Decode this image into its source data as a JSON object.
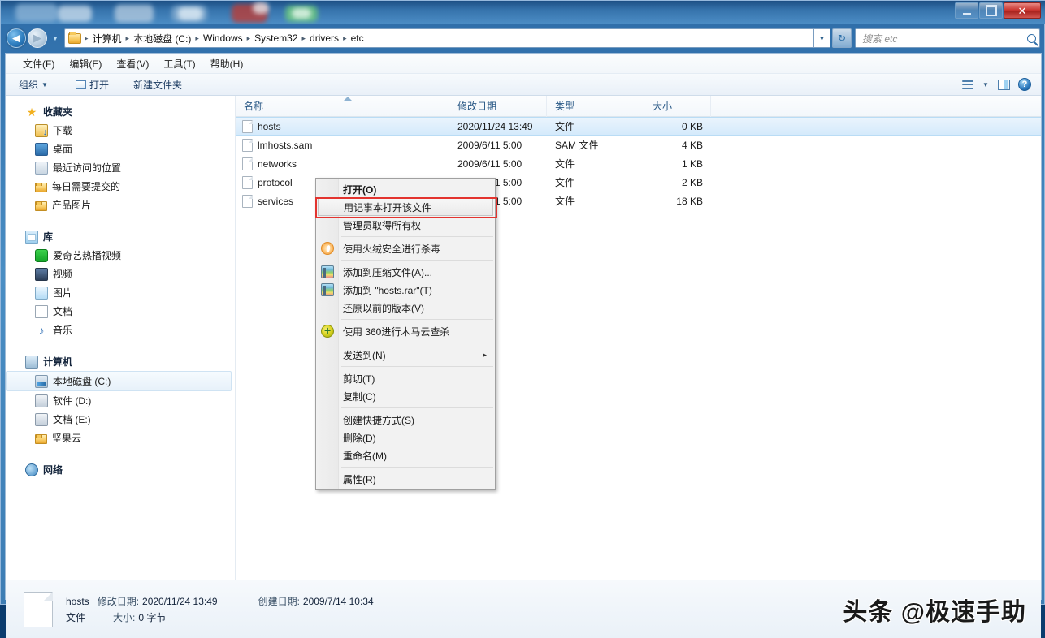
{
  "window": {
    "caption_buttons": [
      {
        "name": "minimize",
        "label": "–"
      },
      {
        "name": "maximize",
        "label": "□"
      },
      {
        "name": "close",
        "label": "✕"
      }
    ]
  },
  "navbar": {
    "back_icon": "◀",
    "forward_icon": "▶",
    "recent_dropdown_icon": "▼",
    "breadcrumbs": [
      "计算机",
      "本地磁盘 (C:)",
      "Windows",
      "System32",
      "drivers",
      "etc"
    ],
    "separator": "▸",
    "address_dropdown_icon": "▼",
    "refresh_icon": "↻",
    "search_placeholder": "搜索 etc",
    "search_value": ""
  },
  "menubar": {
    "items": [
      "文件(F)",
      "编辑(E)",
      "查看(V)",
      "工具(T)",
      "帮助(H)"
    ]
  },
  "toolbar": {
    "organize_label": "组织",
    "organize_caret": "▼",
    "open_label": "打开",
    "newfolder_label": "新建文件夹",
    "views_caret": "▼",
    "help_label": "?"
  },
  "navpane": {
    "groups": [
      {
        "root": {
          "label": "收藏夹",
          "icon": "star-icon"
        },
        "items": [
          {
            "label": "下载",
            "icon": "downloads-icon"
          },
          {
            "label": "桌面",
            "icon": "desktop-icon"
          },
          {
            "label": "最近访问的位置",
            "icon": "recent-places-icon"
          },
          {
            "label": "每日需要提交的",
            "icon": "folder-icon"
          },
          {
            "label": "产品图片",
            "icon": "folder-icon"
          }
        ]
      },
      {
        "root": {
          "label": "库",
          "icon": "library-icon"
        },
        "items": [
          {
            "label": "爱奇艺热播视频",
            "icon": "iqiyi-icon"
          },
          {
            "label": "视频",
            "icon": "video-icon"
          },
          {
            "label": "图片",
            "icon": "pictures-icon"
          },
          {
            "label": "文档",
            "icon": "documents-icon"
          },
          {
            "label": "音乐",
            "icon": "music-icon"
          }
        ]
      },
      {
        "root": {
          "label": "计算机",
          "icon": "computer-icon"
        },
        "items": [
          {
            "label": "本地磁盘 (C:)",
            "icon": "system-drive-icon",
            "selected": true
          },
          {
            "label": "软件 (D:)",
            "icon": "drive-icon"
          },
          {
            "label": "文档 (E:)",
            "icon": "drive-icon"
          },
          {
            "label": "坚果云",
            "icon": "folder-icon"
          }
        ]
      },
      {
        "root": {
          "label": "网络",
          "icon": "network-icon"
        },
        "items": []
      }
    ]
  },
  "filelist": {
    "columns": [
      "名称",
      "修改日期",
      "类型",
      "大小"
    ],
    "sort_column": "名称",
    "sort_direction": "ascending",
    "rows": [
      {
        "name": "hosts",
        "modified": "2020/11/24 13:49",
        "type": "文件",
        "size": "0 KB",
        "selected": true
      },
      {
        "name": "lmhosts.sam",
        "modified": "2009/6/11 5:00",
        "type": "SAM 文件",
        "size": "4 KB",
        "selected": false
      },
      {
        "name": "networks",
        "modified": "2009/6/11 5:00",
        "type": "文件",
        "size": "1 KB",
        "selected": false
      },
      {
        "name": "protocol",
        "modified": "2009/6/11 5:00",
        "type": "文件",
        "size": "2 KB",
        "selected": false
      },
      {
        "name": "services",
        "modified": "2009/6/11 5:00",
        "type": "文件",
        "size": "18 KB",
        "selected": false
      }
    ]
  },
  "contextmenu": {
    "items": [
      {
        "label": "打开(O)",
        "bold": true,
        "icon": null,
        "separator_after": false
      },
      {
        "label": "用记事本打开该文件",
        "highlight": true,
        "icon": null,
        "separator_after": false
      },
      {
        "label": "管理员取得所有权",
        "icon": null,
        "separator_after": true
      },
      {
        "label": "使用火绒安全进行杀毒",
        "icon": "huorong-icon",
        "separator_after": true
      },
      {
        "label": "添加到压缩文件(A)...",
        "icon": "winrar-icon",
        "separator_after": false
      },
      {
        "label": "添加到 \"hosts.rar\"(T)",
        "icon": "winrar-icon",
        "separator_after": false
      },
      {
        "label": "还原以前的版本(V)",
        "icon": null,
        "separator_after": true
      },
      {
        "label": "使用 360进行木马云查杀",
        "icon": "360-icon",
        "separator_after": true
      },
      {
        "label": "发送到(N)",
        "icon": null,
        "submenu": true,
        "separator_after": true
      },
      {
        "label": "剪切(T)",
        "icon": null,
        "separator_after": false
      },
      {
        "label": "复制(C)",
        "icon": null,
        "separator_after": true
      },
      {
        "label": "创建快捷方式(S)",
        "icon": null,
        "separator_after": false
      },
      {
        "label": "删除(D)",
        "icon": null,
        "separator_after": false
      },
      {
        "label": "重命名(M)",
        "icon": null,
        "separator_after": true
      },
      {
        "label": "属性(R)",
        "icon": null,
        "separator_after": false
      }
    ],
    "submenu_arrow": "▸",
    "highlight_border_color": "#e3342f"
  },
  "statusbar": {
    "filename": "hosts",
    "modified_label": "修改日期:",
    "modified_value": "2020/11/24 13:49",
    "created_label": "创建日期:",
    "created_value": "2009/7/14 10:34",
    "type_value": "文件",
    "size_label": "大小:",
    "size_value": "0 字节"
  },
  "watermark": {
    "text": "头条 @极速手助"
  }
}
